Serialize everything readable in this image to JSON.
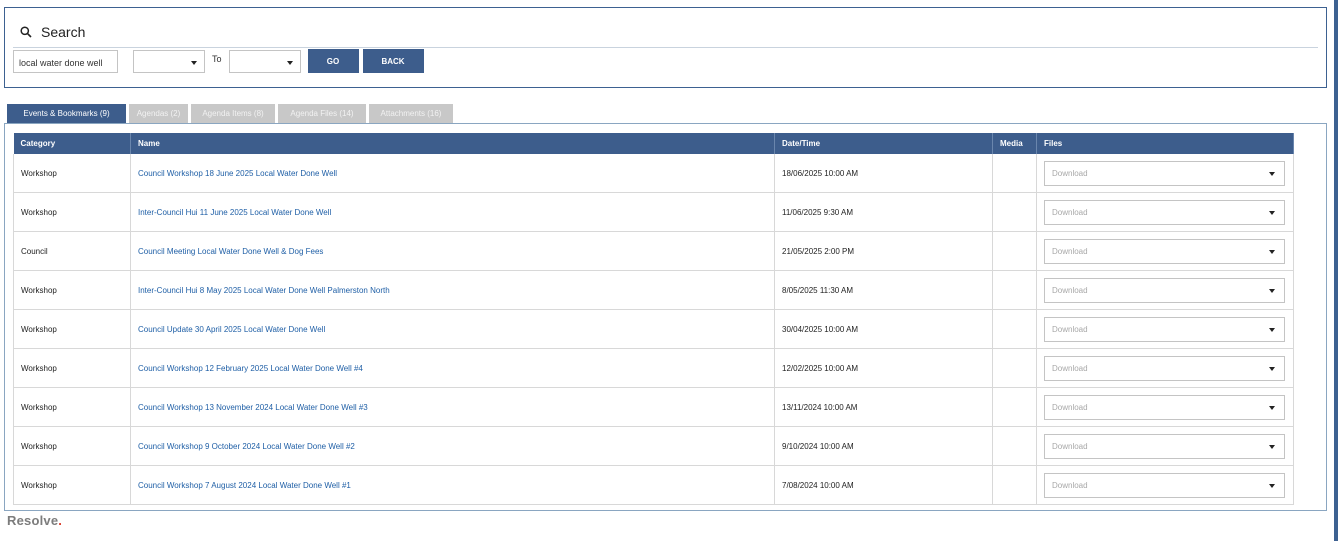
{
  "search": {
    "title": "Search",
    "keyword_value": "local water done well",
    "from_value": "",
    "to_label": "To",
    "to_value": "",
    "go_label": "GO",
    "back_label": "BACK"
  },
  "tabs": [
    {
      "label": "Events & Bookmarks (9)",
      "active": true
    },
    {
      "label": "Agendas (2)",
      "active": false
    },
    {
      "label": "Agenda Items (8)",
      "active": false
    },
    {
      "label": "Agenda Files (14)",
      "active": false
    },
    {
      "label": "Attachments (16)",
      "active": false
    }
  ],
  "table": {
    "columns": [
      "Category",
      "Name",
      "Date/Time",
      "Media",
      "Files"
    ],
    "download_placeholder": "Download",
    "rows": [
      {
        "category": "Workshop",
        "name": "Council Workshop 18 June 2025 Local Water Done Well",
        "datetime": "18/06/2025 10:00 AM",
        "media": ""
      },
      {
        "category": "Workshop",
        "name": "Inter-Council Hui 11 June 2025 Local Water Done Well",
        "datetime": "11/06/2025 9:30 AM",
        "media": ""
      },
      {
        "category": "Council",
        "name": "Council Meeting Local Water Done Well & Dog Fees",
        "datetime": "21/05/2025 2:00 PM",
        "media": ""
      },
      {
        "category": "Workshop",
        "name": "Inter-Council Hui 8 May 2025 Local Water Done Well Palmerston North",
        "datetime": "8/05/2025 11:30 AM",
        "media": ""
      },
      {
        "category": "Workshop",
        "name": "Council Update 30 April 2025 Local Water Done Well",
        "datetime": "30/04/2025 10:00 AM",
        "media": ""
      },
      {
        "category": "Workshop",
        "name": "Council Workshop 12 February 2025 Local Water Done Well #4",
        "datetime": "12/02/2025 10:00 AM",
        "media": ""
      },
      {
        "category": "Workshop",
        "name": "Council Workshop 13 November 2024 Local Water Done Well #3",
        "datetime": "13/11/2024 10:00 AM",
        "media": ""
      },
      {
        "category": "Workshop",
        "name": "Council Workshop 9 October 2024 Local Water Done Well #2",
        "datetime": "9/10/2024 10:00 AM",
        "media": ""
      },
      {
        "category": "Workshop",
        "name": "Council Workshop 7 August 2024 Local Water Done Well #1",
        "datetime": "7/08/2024 10:00 AM",
        "media": ""
      }
    ]
  },
  "footer": {
    "logo_text": "Resolve",
    "logo_dot": "."
  },
  "colors": {
    "primary": "#3d5d8c",
    "link": "#1f5fa6",
    "tab_inactive": "#c8c8c8",
    "logo_accent": "#d93a2a"
  }
}
